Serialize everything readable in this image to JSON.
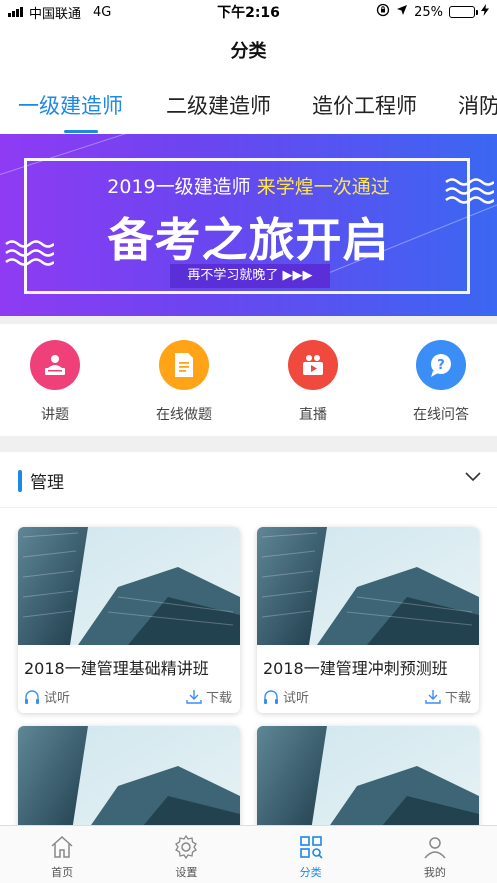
{
  "status_bar": {
    "carrier": "中国联通",
    "network": "4G",
    "time": "下午2:16",
    "battery_percent": "25%",
    "battery_level": 0.25
  },
  "nav": {
    "title": "分类"
  },
  "category_tabs": [
    {
      "label": "一级建造师",
      "active": true
    },
    {
      "label": "二级建造师",
      "active": false
    },
    {
      "label": "造价工程师",
      "active": false
    },
    {
      "label": "消防",
      "active": false
    }
  ],
  "banner": {
    "line1_prefix": "2019一级建造师",
    "line1_highlight": "来学煌一次通过",
    "headline": "备考之旅开启",
    "cta": "再不学习就晚了 ▶▶▶"
  },
  "quick_menu": [
    {
      "label": "讲题",
      "icon": "lecture-icon",
      "color": "#f0407a"
    },
    {
      "label": "在线做题",
      "icon": "document-icon",
      "color": "#ffa416"
    },
    {
      "label": "直播",
      "icon": "video-camera-icon",
      "color": "#f0493e"
    },
    {
      "label": "在线问答",
      "icon": "question-icon",
      "color": "#3a8ef5"
    }
  ],
  "section": {
    "title": "管理"
  },
  "courses": [
    {
      "name": "2018一建管理基础精讲班",
      "listen": "试听",
      "download": "下载"
    },
    {
      "name": "2018一建管理冲刺预测班",
      "listen": "试听",
      "download": "下载"
    },
    {
      "name": "",
      "listen": "",
      "download": ""
    },
    {
      "name": "",
      "listen": "",
      "download": ""
    }
  ],
  "tab_bar": [
    {
      "label": "首页",
      "icon": "home-icon",
      "active": false
    },
    {
      "label": "设置",
      "icon": "gear-icon",
      "active": false
    },
    {
      "label": "分类",
      "icon": "category-grid-icon",
      "active": true
    },
    {
      "label": "我的",
      "icon": "user-icon",
      "active": false
    }
  ],
  "colors": {
    "accent": "#1e88e5",
    "banner_start": "#8f3bf3",
    "banner_end": "#3b67f2"
  }
}
